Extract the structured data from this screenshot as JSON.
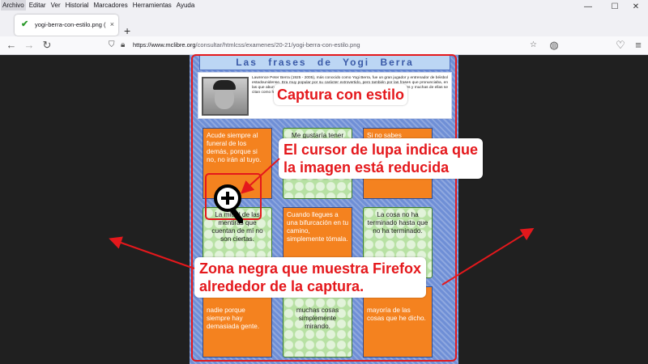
{
  "menu": [
    "Archivo",
    "Editar",
    "Ver",
    "Historial",
    "Marcadores",
    "Herramientas",
    "Ayuda"
  ],
  "window_controls": {
    "minimize": "—",
    "maximize": "☐",
    "close": "✕"
  },
  "tab": {
    "title": "yogi-berra-con-estilo.png (Ima",
    "close": "×",
    "new_tab": "+"
  },
  "url": {
    "host": "https://www.mclibre.org",
    "path": "/consultar/htmlcss/examenes/20-21/yogi-berra-con-estilo.png"
  },
  "page": {
    "title": "Las frases de Yogi Berra",
    "bio": "Lawrence Peter Berra (1925 - 2005), más conocido como Yogi Berra, fue un gran jugador y entrenador de béisbol estadounidense. Era muy popular por su carácter extrovertido, pero también por las frases que pronunciaba, en las que abundaban las contradicciones y sinsentidos. Sus frases se hicieron muy populares y muchas de ellas se citan como humor involuntario con cierta sabiduría.",
    "cells": [
      {
        "text": "Acude siempre al funeral de los demás, porque si no, no irán al tuyo.",
        "style": "orange"
      },
      {
        "text": "Me gustaría tener",
        "style": "green"
      },
      {
        "text": "Si no sabes",
        "style": "orange"
      },
      {
        "text": "La mitad de las mentiras que cuentan de mí no son ciertas.",
        "style": "green"
      },
      {
        "text": "Cuando llegues a una bifurcación en tu camino, simplemente tómala.",
        "style": "orange"
      },
      {
        "text": "La cosa no ha terminado hasta que no ha terminado.",
        "style": "green"
      },
      {
        "text": "nadie porque siempre hay demasiada gente.",
        "style": "orange"
      },
      {
        "text": "muchas cosas simplemente mirando.",
        "style": "green"
      },
      {
        "text": "mayoría de las cosas que he dicho.",
        "style": "orange"
      }
    ]
  },
  "annotations": {
    "capture": "Captura con estilo",
    "cursor_line1": "El cursor de lupa indica que",
    "cursor_line2": "la imagen está reducida",
    "zone_line1": "Zona negra que muestra Firefox",
    "zone_line2": "alrededor de la captura."
  },
  "colors": {
    "annotation": "#e4181c",
    "orange": "#f4821f",
    "green": "#b7e1a3",
    "page_bg": "#6f8fd6"
  }
}
